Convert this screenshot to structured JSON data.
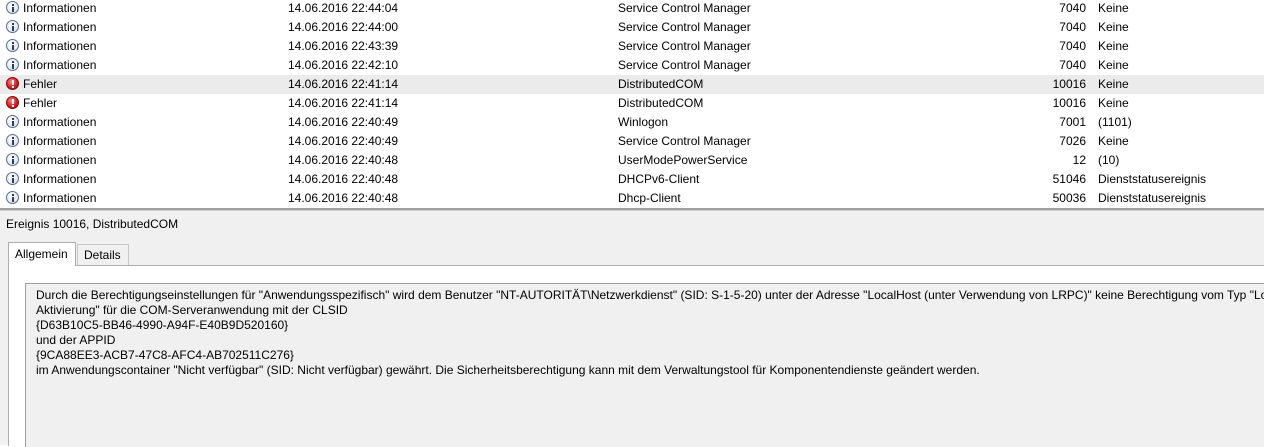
{
  "event_list": {
    "rows": [
      {
        "level": "Informationen",
        "level_icon": "info",
        "date": "14.06.2016 22:44:04",
        "source": "Service Control Manager",
        "event_id": "7040",
        "task": "Keine"
      },
      {
        "level": "Informationen",
        "level_icon": "info",
        "date": "14.06.2016 22:44:00",
        "source": "Service Control Manager",
        "event_id": "7040",
        "task": "Keine"
      },
      {
        "level": "Informationen",
        "level_icon": "info",
        "date": "14.06.2016 22:43:39",
        "source": "Service Control Manager",
        "event_id": "7040",
        "task": "Keine"
      },
      {
        "level": "Informationen",
        "level_icon": "info",
        "date": "14.06.2016 22:42:10",
        "source": "Service Control Manager",
        "event_id": "7040",
        "task": "Keine"
      },
      {
        "level": "Fehler",
        "level_icon": "error",
        "date": "14.06.2016 22:41:14",
        "source": "DistributedCOM",
        "event_id": "10016",
        "task": "Keine",
        "selected": true
      },
      {
        "level": "Fehler",
        "level_icon": "error",
        "date": "14.06.2016 22:41:14",
        "source": "DistributedCOM",
        "event_id": "10016",
        "task": "Keine"
      },
      {
        "level": "Informationen",
        "level_icon": "info",
        "date": "14.06.2016 22:40:49",
        "source": "Winlogon",
        "event_id": "7001",
        "task": "(1101)"
      },
      {
        "level": "Informationen",
        "level_icon": "info",
        "date": "14.06.2016 22:40:49",
        "source": "Service Control Manager",
        "event_id": "7026",
        "task": "Keine"
      },
      {
        "level": "Informationen",
        "level_icon": "info",
        "date": "14.06.2016 22:40:48",
        "source": "UserModePowerService",
        "event_id": "12",
        "task": "(10)"
      },
      {
        "level": "Informationen",
        "level_icon": "info",
        "date": "14.06.2016 22:40:48",
        "source": "DHCPv6-Client",
        "event_id": "51046",
        "task": "Dienststatusereignis"
      },
      {
        "level": "Informationen",
        "level_icon": "info",
        "date": "14.06.2016 22:40:48",
        "source": "Dhcp-Client",
        "event_id": "50036",
        "task": "Dienststatusereignis"
      }
    ]
  },
  "detail": {
    "title": "Ereignis 10016, DistributedCOM",
    "tabs": [
      {
        "label": "Allgemein",
        "active": true
      },
      {
        "label": "Details",
        "active": false
      }
    ],
    "description_lines": [
      "Durch die Berechtigungseinstellungen für \"Anwendungsspezifisch\" wird dem Benutzer \"NT-AUTORITÄT\\Netzwerkdienst\" (SID: S-1-5-20) unter der Adresse \"LocalHost (unter Verwendung von LRPC)\" keine Berechtigung vom Typ \"Lokal",
      "Aktivierung\" für die COM-Serveranwendung mit der CLSID",
      "{D63B10C5-BB46-4990-A94F-E40B9D520160}",
      " und der APPID",
      "{9CA88EE3-ACB7-47C8-AFC4-AB702511C276}",
      " im Anwendungscontainer \"Nicht verfügbar\" (SID: Nicht verfügbar) gewährt. Die Sicherheitsberechtigung kann mit dem Verwaltungstool für Komponentendienste geändert werden."
    ]
  },
  "colors": {
    "selected_row": "#ebebeb",
    "panel_background": "#f0f0f0",
    "error_icon": "#d62020",
    "info_icon": "#5a6d8a"
  }
}
